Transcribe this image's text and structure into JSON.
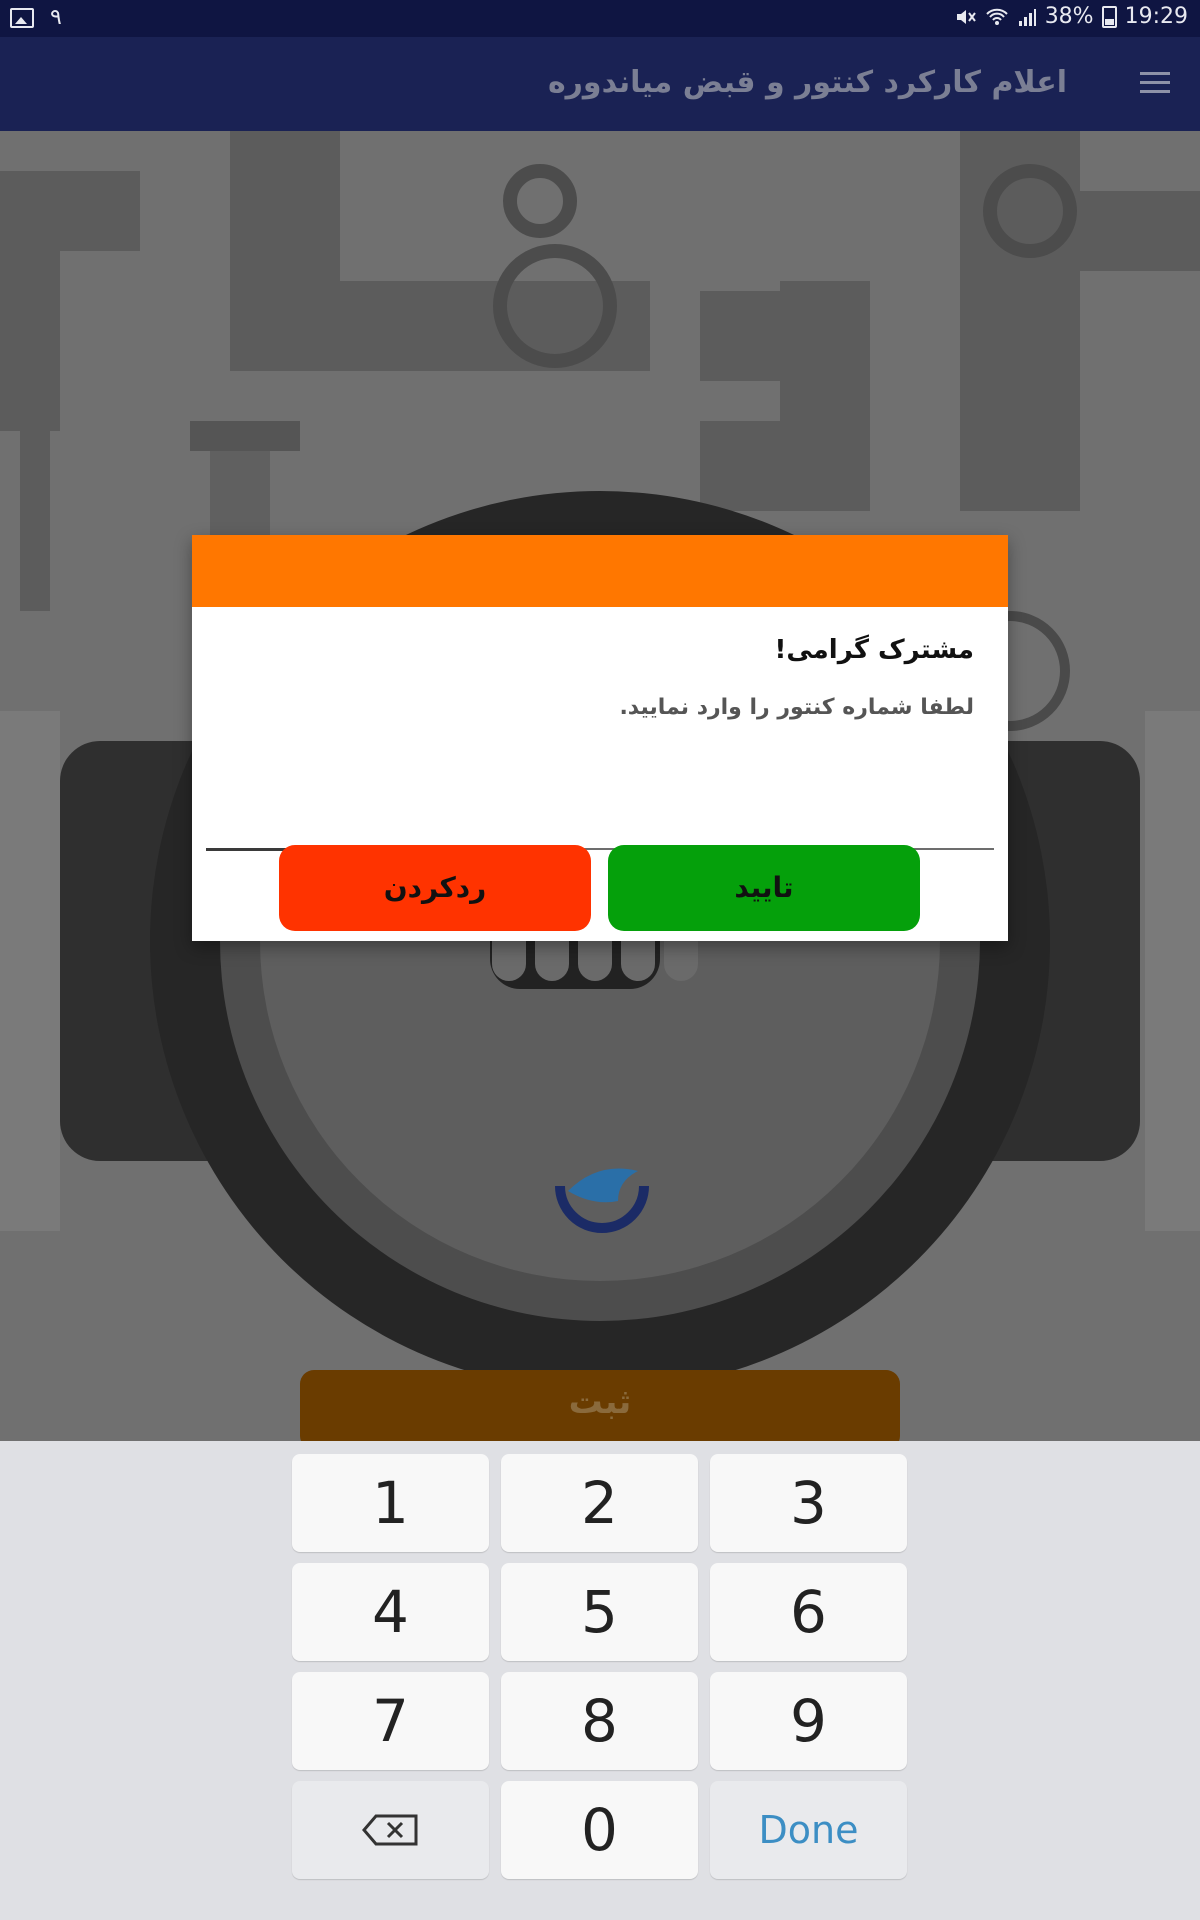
{
  "status_bar": {
    "left_text": "۹",
    "battery": "38%",
    "time": "19:29",
    "icons": [
      "gallery-icon",
      "mute-icon",
      "wifi-icon",
      "signal-icon",
      "battery-icon"
    ]
  },
  "app_bar": {
    "title": "اعلام کارکرد کنتور و قبض میاندوره",
    "menu_icon": "hamburger-menu-icon"
  },
  "background": {
    "submit_label": "ثبت"
  },
  "dialog": {
    "header_color": "#ff7700",
    "greeting": "مشترک گرامی!",
    "message": "لطفا شماره کنتور را وارد نمایید.",
    "digit_fields": [
      "",
      "",
      "",
      "",
      ""
    ],
    "confirm_label": "تایید",
    "cancel_label": "ردکردن",
    "confirm_color": "#05a00b",
    "cancel_color": "#ff3300"
  },
  "keyboard": {
    "rows": [
      [
        "1",
        "2",
        "3"
      ],
      [
        "4",
        "5",
        "6"
      ],
      [
        "7",
        "8",
        "9"
      ],
      [
        "⌫",
        "0",
        "Done"
      ]
    ],
    "done_color": "#3c8ec4"
  }
}
